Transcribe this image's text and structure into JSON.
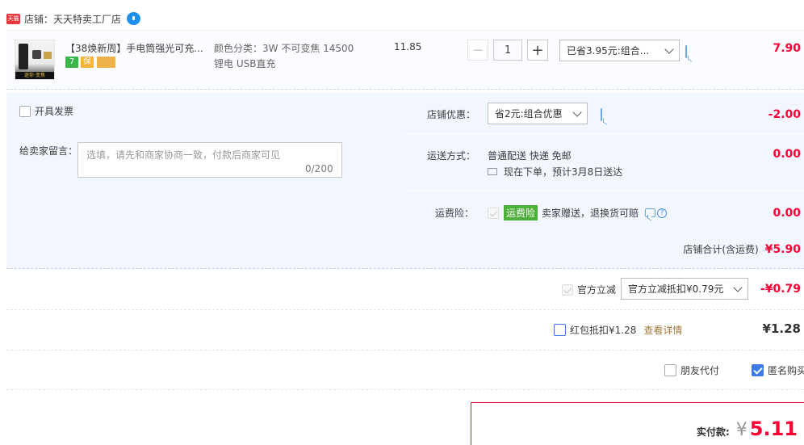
{
  "shop": {
    "badge": "天猫",
    "label": "店铺：天天特卖工厂店"
  },
  "item": {
    "title": "【38焕新周】手电筒强光可充...",
    "sku_line1": "颜色分类：3W 不可变焦 14500",
    "sku_line2": "锂电 USB直充",
    "unit_price": "11.85",
    "quantity": "1",
    "promo": "已省3.95元:组合...",
    "total": "7.90",
    "thumb_text": "迷你·变焦",
    "tags": [
      {
        "text": "7",
        "color": "#3ab549"
      },
      {
        "text": "保",
        "color": "#f7b23b"
      },
      {
        "text": "",
        "color": "#f0b24a"
      }
    ]
  },
  "invoice": {
    "label": "开具发票"
  },
  "message": {
    "label": "给卖家留言：",
    "placeholder": "选填，请先和商家协商一致，付款后商家可见",
    "counter": "0/200"
  },
  "shop_discount": {
    "label": "店铺优惠：",
    "selected": "省2元:组合优惠",
    "amount": "-2.00"
  },
  "shipping": {
    "label": "运送方式：",
    "method": "普通配送 快递 免邮",
    "eta": "现在下单，预计3月8日送达",
    "amount": "0.00"
  },
  "insurance": {
    "label": "运费险：",
    "badge": "运费险",
    "desc": "卖家赠送，退换货可赔",
    "amount": "0.00"
  },
  "shop_total": {
    "label": "店铺合计(含运费)",
    "amount": "¥5.90"
  },
  "official": {
    "label": "官方立减",
    "selected": "官方立减抵扣¥0.79元",
    "amount": "-¥0.79"
  },
  "redpacket": {
    "label": "红包抵扣¥1.28",
    "link": "查看详情",
    "amount": "¥1.28"
  },
  "options": {
    "friend_pay": "朋友代付",
    "anonymous": "匿名购买"
  },
  "payment": {
    "label": "实付款:",
    "currency": "¥",
    "amount": "5.11"
  }
}
